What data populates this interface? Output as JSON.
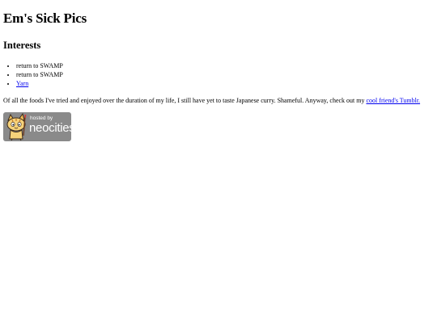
{
  "page": {
    "title": "Em's Sick Pics"
  },
  "interests": {
    "heading": "Interests",
    "items": [
      {
        "text": "return to SWAMP",
        "is_link": false
      },
      {
        "text": "return to SWAMP",
        "is_link": false
      },
      {
        "text": "Yarn",
        "is_link": true
      }
    ]
  },
  "blurb": {
    "text": "Of all the foods I've tried and enjoyed over the duration of my life, I still have yet to taste Japanese curry. Shameful. Anyway, check out my ",
    "link_text": "cool friend's Tumblr."
  },
  "badge": {
    "hosted_label": "hosted by",
    "brand_label": "neocities",
    "background_color": "#8a8a8a",
    "link_color": "#0000ee"
  }
}
